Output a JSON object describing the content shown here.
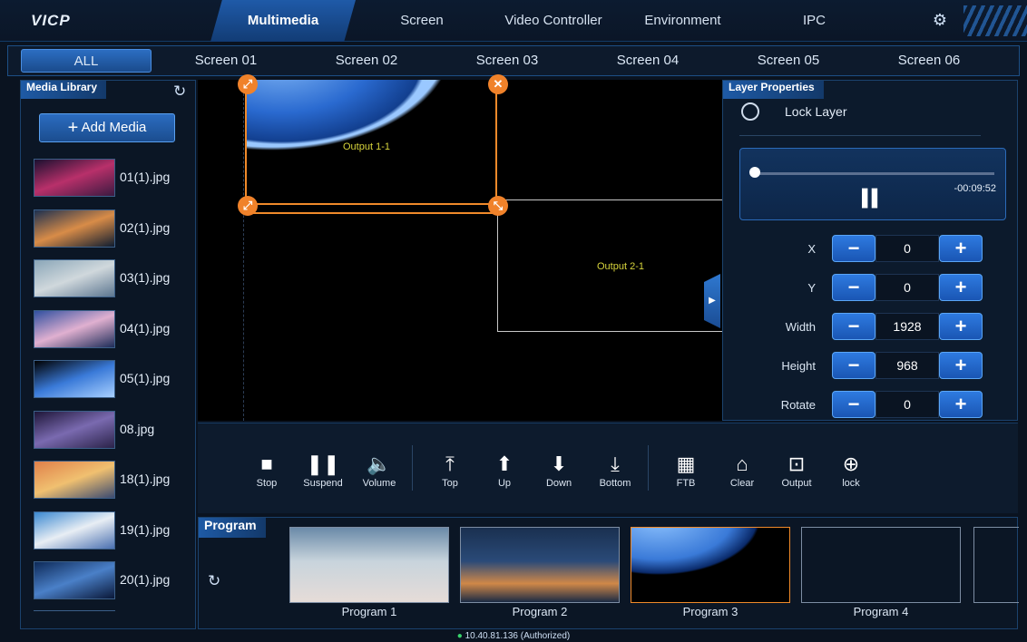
{
  "app": {
    "logo": "VICP"
  },
  "nav": {
    "tabs": [
      {
        "label": "Multimedia",
        "active": true
      },
      {
        "label": "Screen"
      },
      {
        "label": "Video Controller"
      },
      {
        "label": "Environment"
      },
      {
        "label": "IPC"
      }
    ],
    "settings_icon": "gear-icon"
  },
  "screen_tabs": [
    "ALL",
    "Screen 01",
    "Screen 02",
    "Screen 03",
    "Screen 04",
    "Screen 05",
    "Screen 06"
  ],
  "media_library": {
    "title": "Media Library",
    "add_label": "Add Media",
    "items": [
      {
        "name": "01(1).jpg",
        "colors": [
          "#1a1030",
          "#b8306a",
          "#3a1a40"
        ]
      },
      {
        "name": "02(1).jpg",
        "colors": [
          "#1c3050",
          "#d88c48",
          "#0e1c30"
        ]
      },
      {
        "name": "03(1).jpg",
        "colors": [
          "#8aa6b8",
          "#d0d8dc",
          "#5c7690"
        ]
      },
      {
        "name": "04(1).jpg",
        "colors": [
          "#3050a0",
          "#e0b0d0",
          "#1c2c58"
        ]
      },
      {
        "name": "05(1).jpg",
        "colors": [
          "#000000",
          "#3a7ad8",
          "#a8d0ff"
        ]
      },
      {
        "name": "08.jpg",
        "colors": [
          "#1e1638",
          "#7a6ab0",
          "#2a2248"
        ]
      },
      {
        "name": "18(1).jpg",
        "colors": [
          "#e0804a",
          "#f0c070",
          "#3a4a70"
        ]
      },
      {
        "name": "19(1).jpg",
        "colors": [
          "#3a88d0",
          "#e8eef4",
          "#4a70b0"
        ]
      },
      {
        "name": "20(1).jpg",
        "colors": [
          "#0e2a58",
          "#4a80c8",
          "#0a1838"
        ]
      }
    ]
  },
  "canvas": {
    "outputs": [
      {
        "label": "Output 1-1"
      },
      {
        "label": "Output 2-1"
      }
    ]
  },
  "layer_properties": {
    "title": "Layer Properties",
    "lock_label": "Lock Layer",
    "player": {
      "time": "-00:09:52",
      "progress": 0.0
    },
    "fields": [
      {
        "label": "X",
        "value": "0"
      },
      {
        "label": "Y",
        "value": "0"
      },
      {
        "label": "Width",
        "value": "1928"
      },
      {
        "label": "Height",
        "value": "968"
      },
      {
        "label": "Rotate",
        "value": "0"
      }
    ]
  },
  "toolbar": {
    "tools": [
      {
        "label": "Stop",
        "icon": "stop-icon"
      },
      {
        "label": "Suspend",
        "icon": "pause-icon"
      },
      {
        "label": "Volume",
        "icon": "volume-icon"
      },
      {
        "label": "Top",
        "icon": "move-top-icon"
      },
      {
        "label": "Up",
        "icon": "move-up-icon"
      },
      {
        "label": "Down",
        "icon": "move-down-icon"
      },
      {
        "label": "Bottom",
        "icon": "move-bottom-icon"
      },
      {
        "label": "FTB",
        "icon": "ftb-icon"
      },
      {
        "label": "Clear",
        "icon": "clear-icon"
      },
      {
        "label": "Output",
        "icon": "output-icon"
      },
      {
        "label": "lock",
        "icon": "lock-icon"
      }
    ]
  },
  "program": {
    "title": "Program",
    "slots": [
      {
        "label": "Program 1"
      },
      {
        "label": "Program 2"
      },
      {
        "label": "Program 3",
        "selected": true
      },
      {
        "label": "Program 4"
      }
    ]
  },
  "status": {
    "text": "10.40.81.136 (Authorized)"
  }
}
